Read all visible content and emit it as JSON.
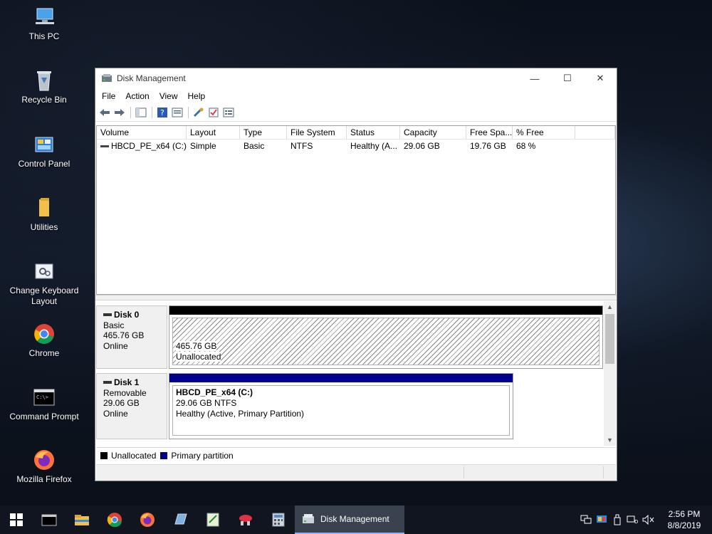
{
  "desktop": {
    "icons": [
      {
        "label": "This PC"
      },
      {
        "label": "Recycle Bin"
      },
      {
        "label": "Control Panel"
      },
      {
        "label": "Utilities"
      },
      {
        "label": "Change Keyboard Layout"
      },
      {
        "label": "Chrome"
      },
      {
        "label": "Command Prompt"
      },
      {
        "label": "Mozilla Firefox"
      }
    ]
  },
  "window": {
    "title": "Disk Management",
    "controls": {
      "minimize": "—",
      "maximize": "☐",
      "close": "✕"
    }
  },
  "menu": [
    "File",
    "Action",
    "View",
    "Help"
  ],
  "volumes": {
    "columns": [
      "Volume",
      "Layout",
      "Type",
      "File System",
      "Status",
      "Capacity",
      "Free Spa...",
      "% Free",
      ""
    ],
    "rows": [
      {
        "volume": "HBCD_PE_x64 (C:)",
        "layout": "Simple",
        "type": "Basic",
        "fs": "NTFS",
        "status": "Healthy (A...",
        "capacity": "29.06 GB",
        "free": "19.76 GB",
        "pct": "68 %"
      }
    ]
  },
  "disks": [
    {
      "name": "Disk 0",
      "type": "Basic",
      "size": "465.76 GB",
      "state": "Online",
      "partition": {
        "line1": "465.76 GB",
        "line2": "Unallocated"
      }
    },
    {
      "name": "Disk 1",
      "type": "Removable",
      "size": "29.06 GB",
      "state": "Online",
      "partition": {
        "title": "HBCD_PE_x64  (C:)",
        "line1": "29.06 GB NTFS",
        "line2": "Healthy (Active, Primary Partition)"
      }
    }
  ],
  "legend": [
    {
      "label": "Unallocated",
      "color": "#000000"
    },
    {
      "label": "Primary partition",
      "color": "#00008b"
    }
  ],
  "taskbar": {
    "active_task": "Disk Management",
    "clock": {
      "time": "2:56 PM",
      "date": "8/8/2019"
    }
  },
  "colors": {
    "primary_partition": "#00008b",
    "unallocated": "#000000",
    "taskbar": "#101520"
  }
}
